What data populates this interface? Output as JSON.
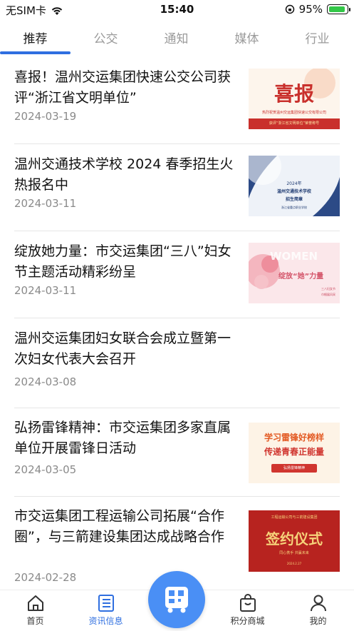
{
  "status_bar": {
    "carrier": "无SIM卡",
    "time": "15:40",
    "battery_percent": "95%"
  },
  "tabs": [
    {
      "label": "推荐",
      "active": true
    },
    {
      "label": "公交",
      "active": false
    },
    {
      "label": "通知",
      "active": false
    },
    {
      "label": "媒体",
      "active": false
    },
    {
      "label": "行业",
      "active": false
    }
  ],
  "articles": [
    {
      "title": "喜报！温州交运集团快速公交公司获评“浙江省文明单位”",
      "date": "2024-03-19",
      "thumb": {
        "big": "喜报",
        "line1": "热烈祝贺温州交运集团快速公交有限公司",
        "line2": "获评“浙江省文明单位”荣誉称号"
      }
    },
    {
      "title": "温州交通技术学校 2024 春季招生火热报名中",
      "date": "2024-03-11",
      "thumb": {
        "line1": "2024年",
        "line2": "温州交通技术学校",
        "line3": "招生简章",
        "line4": "浙江省重点职业学校"
      }
    },
    {
      "title": "绽放她力量：市交运集团“三八”妇女节主题活动精彩纷呈",
      "date": "2024-03-11",
      "thumb": {
        "en": "WOMEN",
        "main": "绽放“她”力量",
        "line1": "三八妇女节",
        "line2": "巾帼展风采"
      }
    },
    {
      "title": "温州交运集团妇女联合会成立暨第一次妇女代表大会召开",
      "date": "2024-03-08"
    },
    {
      "title": "弘扬雷锋精神：市交运集团多家直属单位开展雷锋日活动",
      "date": "2024-03-05",
      "thumb": {
        "line1": "学习雷锋好榜样",
        "line2": "传递青春正能量",
        "badge": "弘扬雷锋精神"
      }
    },
    {
      "title": "市交运集团工程运输公司拓展“合作圈”，与三箭建设集团达成战略合作",
      "date": "2024-02-28",
      "thumb": {
        "top": "工程运输公司与三箭建设集团",
        "main": "签约仪式",
        "sub": "同心携手 共赢未来",
        "date": "2024.2.27"
      }
    }
  ],
  "bottom_nav": [
    {
      "label": "首页",
      "active": false
    },
    {
      "label": "资讯信息",
      "active": true
    },
    {
      "label": "积分商城",
      "active": false
    },
    {
      "label": "我的",
      "active": false
    }
  ],
  "colors": {
    "accent": "#2f6fe0",
    "fab": "#4a8ff5"
  }
}
